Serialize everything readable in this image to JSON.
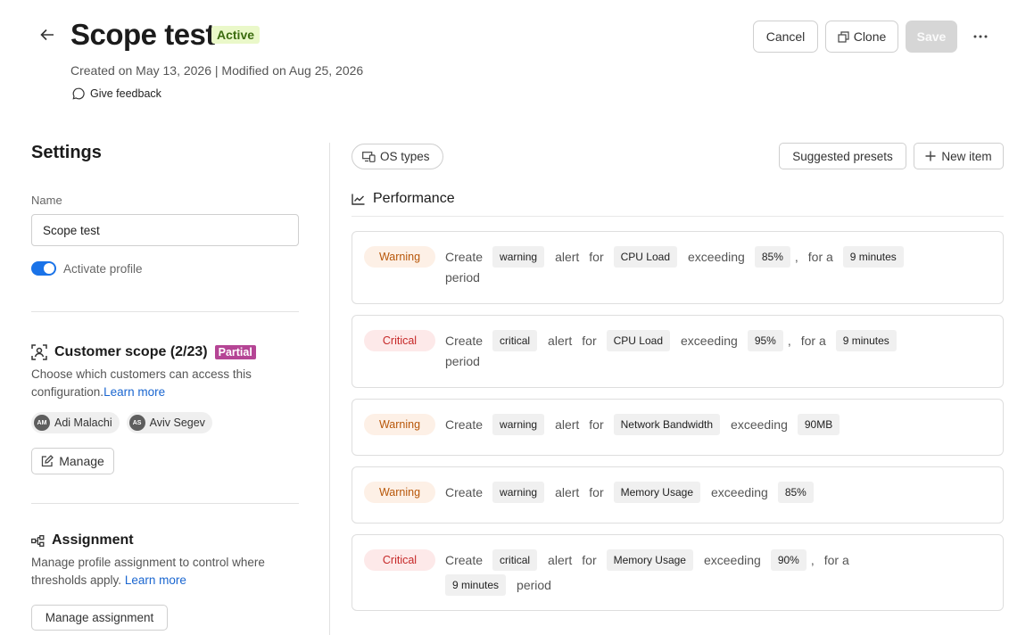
{
  "header": {
    "title": "Scope test",
    "status": "Active",
    "meta": "Created on May 13, 2026 | Modified on Aug 25, 2026",
    "feedback": "Give feedback",
    "cancel": "Cancel",
    "clone": "Clone",
    "save": "Save"
  },
  "settings": {
    "title": "Settings",
    "name_label": "Name",
    "name_value": "Scope test",
    "activate_label": "Activate profile",
    "activate_on": true
  },
  "scope": {
    "title": "Customer scope (2/23)",
    "badge": "Partial",
    "desc": "Choose which customers can access this configuration.",
    "learn_more": "Learn more",
    "users": [
      {
        "initials": "AM",
        "name": "Adi Malachi"
      },
      {
        "initials": "AS",
        "name": "Aviv Segev"
      }
    ],
    "manage": "Manage"
  },
  "assignment": {
    "title": "Assignment",
    "desc": "Manage profile assignment to control where thresholds apply.",
    "learn_more": "Learn more",
    "button": "Manage assignment"
  },
  "toolbar": {
    "os_types": "OS types",
    "presets": "Suggested presets",
    "new_item": "New item"
  },
  "performance": {
    "title": "Performance",
    "words": {
      "create": "Create",
      "alert": "alert",
      "for": "for",
      "exceeding": "exceeding",
      "comma": ",",
      "for_a": "for a",
      "period": "period"
    },
    "items": [
      {
        "severity": "Warning",
        "level": "warning",
        "metric": "CPU Load",
        "threshold": "85%",
        "duration": "9 minutes"
      },
      {
        "severity": "Critical",
        "level": "critical",
        "metric": "CPU Load",
        "threshold": "95%",
        "duration": "9 minutes"
      },
      {
        "severity": "Warning",
        "level": "warning",
        "metric": "Network Bandwidth",
        "threshold": "90MB"
      },
      {
        "severity": "Warning",
        "level": "warning",
        "metric": "Memory Usage",
        "threshold": "85%"
      },
      {
        "severity": "Critical",
        "level": "critical",
        "metric": "Memory Usage",
        "threshold": "90%",
        "duration": "9 minutes"
      }
    ]
  },
  "colors": {
    "accent": "#1a73e8",
    "warning": "#b8570a",
    "critical": "#c62828",
    "partial": "#b54595",
    "active_bg": "#eaf8c9"
  }
}
